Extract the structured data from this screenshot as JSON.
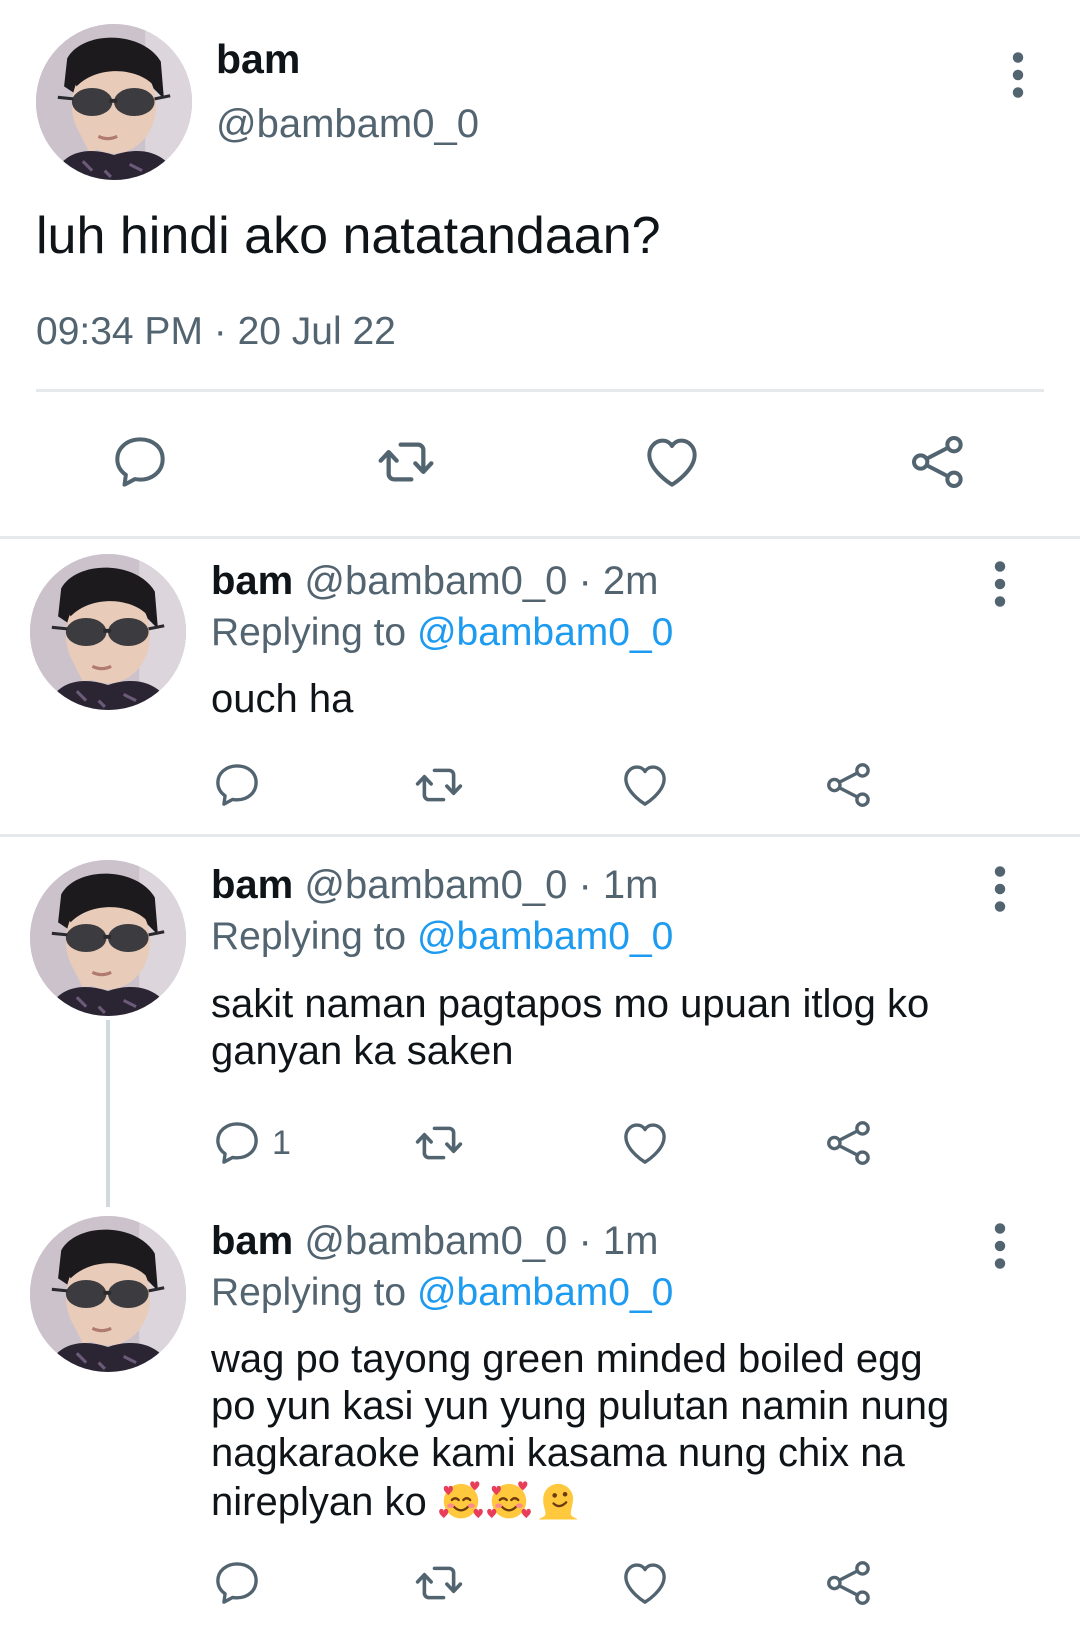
{
  "main": {
    "name": "bam",
    "handle": "@bambam0_0",
    "text": "luh hindi ako natatandaan?",
    "timestamp": "09:34 PM · 20 Jul 22"
  },
  "replies": [
    {
      "name": "bam",
      "handle": "@bambam0_0",
      "dot": "·",
      "time": "2m",
      "replying_prefix": "Replying to",
      "replying_to": "@bambam0_0",
      "text": "ouch ha",
      "reply_count": ""
    },
    {
      "name": "bam",
      "handle": "@bambam0_0",
      "dot": "·",
      "time": "1m",
      "replying_prefix": "Replying to",
      "replying_to": "@bambam0_0",
      "text_line1": "sakit naman pagtapos mo upuan itlog ko",
      "text_line2": "ganyan ka saken",
      "reply_count": "1"
    },
    {
      "name": "bam",
      "handle": "@bambam0_0",
      "dot": "·",
      "time": "1m",
      "replying_prefix": "Replying to",
      "replying_to": "@bambam0_0",
      "text_line1": "wag po tayong green minded boiled egg",
      "text_line2": "po yun kasi yun yung pulutan namin nung",
      "text_line3": "nagkaraoke kami kasama nung chix na",
      "text_line4": "nireplyan ko",
      "emojis": [
        "smiling-face-with-hearts",
        "smiling-face-with-hearts",
        "melting-face"
      ],
      "reply_count": ""
    }
  ],
  "icons": {
    "reply": "speech-bubble-icon",
    "retweet": "retweet-icon",
    "like": "heart-icon",
    "share": "share-icon",
    "more": "more-vertical-icon"
  },
  "colors": {
    "text": "#0f1419",
    "secondary": "#536471",
    "link": "#1d9bf0",
    "divider": "#e6e9ec",
    "icon": "#536471"
  }
}
